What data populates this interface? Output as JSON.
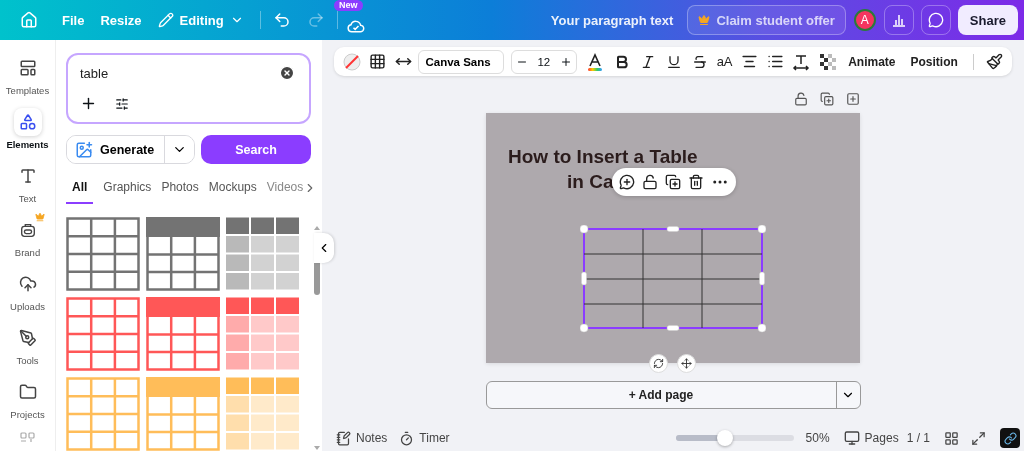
{
  "top_bar": {
    "menu": [
      {
        "label": "File"
      },
      {
        "label": "Resize"
      }
    ],
    "mode": "Editing",
    "new_badge": "New",
    "doc_title": "Your paragraph text",
    "offer": "Claim student offer",
    "avatar": "A",
    "share": "Share"
  },
  "rail": [
    {
      "kind": "templates",
      "label": "Templates",
      "selected": false
    },
    {
      "kind": "elements",
      "label": "Elements",
      "selected": true
    },
    {
      "kind": "text",
      "label": "Text",
      "selected": false
    },
    {
      "kind": "brand",
      "label": "Brand",
      "selected": false
    },
    {
      "kind": "uploads",
      "label": "Uploads",
      "selected": false
    },
    {
      "kind": "tools",
      "label": "Tools",
      "selected": false
    },
    {
      "kind": "projects",
      "label": "Projects",
      "selected": false
    }
  ],
  "search": {
    "value": "table"
  },
  "generate": "Generate",
  "search_button": "Search",
  "filter_tabs": [
    {
      "label": "All",
      "selected": true
    },
    {
      "label": "Graphics",
      "selected": false
    },
    {
      "label": "Photos",
      "selected": false
    },
    {
      "label": "Mockups",
      "selected": false
    },
    {
      "label": "Videos",
      "selected": false
    }
  ],
  "results": [
    {
      "kind": "grid",
      "color": "#737373"
    },
    {
      "kind": "header",
      "color": "#737373"
    },
    {
      "kind": "blocks",
      "color": "#737373"
    },
    {
      "kind": "grid",
      "color": "#ff5757"
    },
    {
      "kind": "header",
      "color": "#ff5757"
    },
    {
      "kind": "blocks",
      "color": "#ff5757"
    },
    {
      "kind": "grid",
      "color": "#ffbd59"
    },
    {
      "kind": "header",
      "color": "#ffbd59"
    },
    {
      "kind": "blocks",
      "color": "#ffbd59"
    }
  ],
  "text_toolbar": {
    "font": "Canva Sans",
    "size": "12",
    "case": "aA",
    "actions": [
      "Animate",
      "Position"
    ]
  },
  "page": {
    "title_lines": [
      "How to Insert a Table",
      "in Ca"
    ]
  },
  "add_page": "+ Add page",
  "bottom_bar": {
    "notes": "Notes",
    "timer": "Timer",
    "zoom": {
      "level": 0.42
    },
    "zoom_reading": "50%",
    "pages": "Pages",
    "page_count": "1 / 1"
  }
}
